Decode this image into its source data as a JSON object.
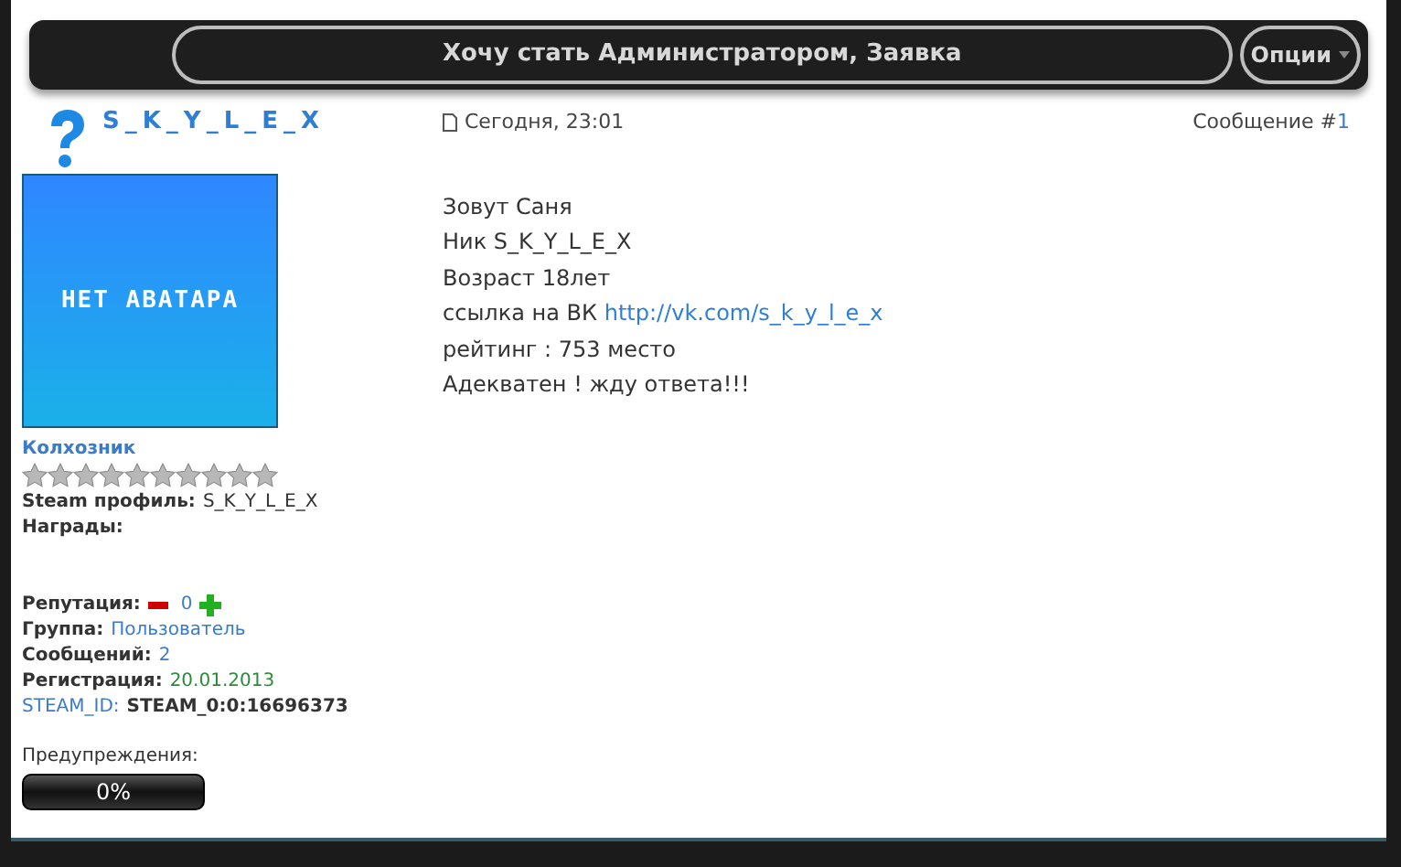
{
  "thread": {
    "title": "Хочу стать Администратором, Заявка",
    "options": "Опции"
  },
  "post": {
    "author": "S_K_Y_L_E_X",
    "avatar_text": "НЕТ АВАТАРА",
    "rank": "Колхозник",
    "stars": 0,
    "fields": [
      {
        "kind": "plain",
        "label": "Steam профиль:",
        "value": "S_K_Y_L_E_X"
      },
      {
        "kind": "plain",
        "label": "Награды:"
      },
      {
        "kind": "gap"
      },
      {
        "kind": "reputation",
        "label": "Репутация:",
        "value": "0"
      },
      {
        "kind": "link",
        "label": "Группа:",
        "value": "Пользователь"
      },
      {
        "kind": "link",
        "label": "Сообщений:",
        "value": "2"
      },
      {
        "kind": "date",
        "label": "Регистрация:",
        "value": "20.01.2013"
      },
      {
        "kind": "steamid",
        "label": "STEAM_ID:",
        "value": "STEAM_0:0:16696373"
      }
    ],
    "warnings": {
      "label": "Предупреждения:",
      "level": 0,
      "reading": "0%"
    },
    "date": "Сегодня, 23:01",
    "number_label": "Сообщение #",
    "number": "1",
    "lines": [
      {
        "text": "Зовут Саня"
      },
      {
        "text": "Ник S_K_Y_L_E_X"
      },
      {
        "text": "Возраст 18лет"
      },
      {
        "text": "ссылка на ВК ",
        "link": "http://vk.com/s_k_y_l_e_x"
      },
      {
        "text": "рейтинг : 753 место"
      },
      {
        "text": "Адекватен ! жду ответа!!!"
      }
    ]
  }
}
